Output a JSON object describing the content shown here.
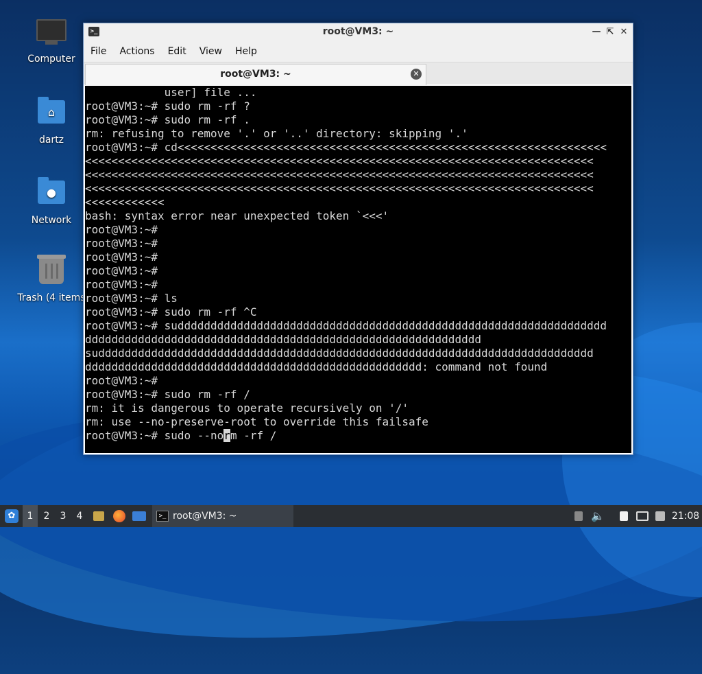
{
  "desktop": {
    "icons": [
      {
        "label": "Computer",
        "icon": "computer-icon"
      },
      {
        "label": "dartz",
        "icon": "home-folder-icon"
      },
      {
        "label": "Network",
        "icon": "network-folder-icon"
      },
      {
        "label": "Trash (4 items",
        "icon": "trash-icon"
      }
    ]
  },
  "window": {
    "title": "root@VM3: ~",
    "menu": [
      "File",
      "Actions",
      "Edit",
      "View",
      "Help"
    ],
    "tab_title": "root@VM3: ~"
  },
  "terminal": {
    "lines": [
      "            user] file ...",
      "root@VM3:~# sudo rm -rf ?",
      "root@VM3:~# sudo rm -rf .",
      "rm: refusing to remove '.' or '..' directory: skipping '.'",
      "root@VM3:~# cd<<<<<<<<<<<<<<<<<<<<<<<<<<<<<<<<<<<<<<<<<<<<<<<<<<<<<<<<<<<<<<<<<",
      "<<<<<<<<<<<<<<<<<<<<<<<<<<<<<<<<<<<<<<<<<<<<<<<<<<<<<<<<<<<<<<<<<<<<<<<<<<<<<",
      "<<<<<<<<<<<<<<<<<<<<<<<<<<<<<<<<<<<<<<<<<<<<<<<<<<<<<<<<<<<<<<<<<<<<<<<<<<<<<",
      "<<<<<<<<<<<<<<<<<<<<<<<<<<<<<<<<<<<<<<<<<<<<<<<<<<<<<<<<<<<<<<<<<<<<<<<<<<<<<",
      "<<<<<<<<<<<<",
      "bash: syntax error near unexpected token `<<<'",
      "root@VM3:~#",
      "root@VM3:~#",
      "root@VM3:~#",
      "root@VM3:~#",
      "root@VM3:~#",
      "root@VM3:~# ls",
      "root@VM3:~# sudo rm -rf ^C",
      "root@VM3:~# suddddddddddddddddddddddddddddddddddddddddddddddddddddddddddddddddd",
      "dddddddddddddddddddddddddddddddddddddddddddddddddddddddddddd",
      "suddddddddddddddddddddddddddddddddddddddddddddddddddddddddddddddddddddddddddd",
      "ddddddddddddddddddddddddddddddddddddddddddddddddddd: command not found",
      "root@VM3:~#",
      "root@VM3:~# sudo rm -rf /",
      "rm: it is dangerous to operate recursively on '/'",
      "rm: use --no-preserve-root to override this failsafe"
    ],
    "prompt_line_before_cursor": "root@VM3:~# sudo --no",
    "cursor_char": "r",
    "prompt_line_after_cursor": "m -rf /"
  },
  "taskbar": {
    "workspaces": [
      "1",
      "2",
      "3",
      "4"
    ],
    "active_workspace": "1",
    "task_label": "root@VM3: ~",
    "clock": "21:08"
  }
}
